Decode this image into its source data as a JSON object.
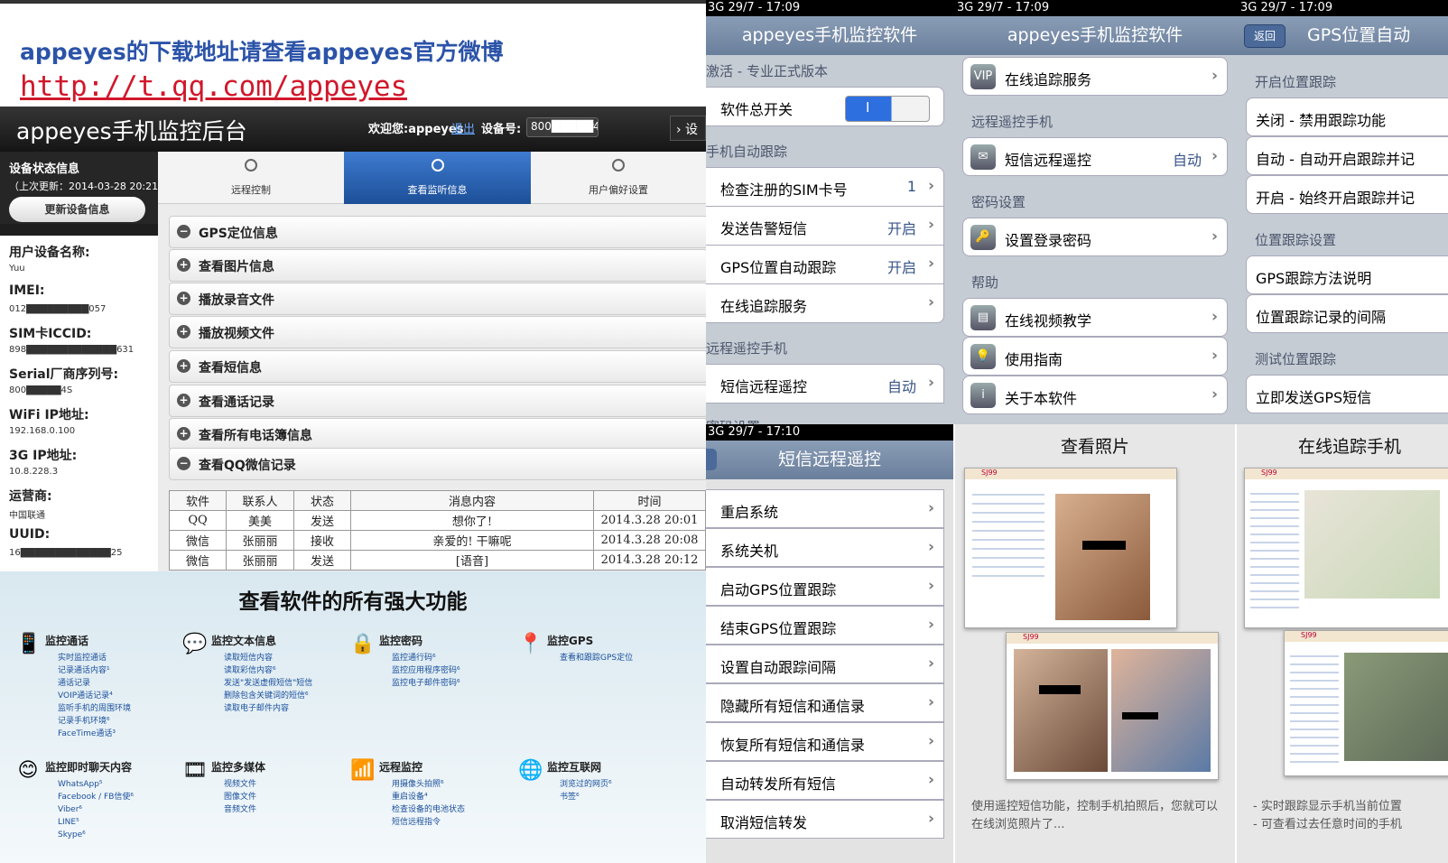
{
  "banner": {
    "line": "appeyes的下载地址请查看appeyes官方微博",
    "url": "http://t.qq.com/appeyes"
  },
  "admin": {
    "title": "appeyes手机监控后台",
    "welcome": "欢迎您:appeyes",
    "logout": "退出",
    "device_label": "设备号:",
    "device_value": "800█████4S",
    "right_btn": "›  设",
    "status_title": "设备状态信息",
    "status_time": "（上次更新：2014-03-28 20:21:00）",
    "update_btn": "更新设备信息",
    "device_info": [
      {
        "key": "用户设备名称:",
        "value": "Yuu"
      },
      {
        "key": "IMEI:",
        "value": "012█████████057"
      },
      {
        "key": "SIM卡ICCID:",
        "value": "898█████████████631"
      },
      {
        "key": "Serial厂商序列号:",
        "value": "800█████4S"
      },
      {
        "key": "WiFi IP地址:",
        "value": "192.168.0.100"
      },
      {
        "key": "3G IP地址:",
        "value": "10.8.228.3"
      },
      {
        "key": "运营商:",
        "value": "中国联通"
      },
      {
        "key": "UUID:",
        "value": "16█████████████25"
      }
    ],
    "tabs": [
      "远程控制",
      "查看监听信息",
      "用户偏好设置"
    ],
    "panel_rows": [
      {
        "icon": "−",
        "label": "GPS定位信息"
      },
      {
        "icon": "+",
        "label": "查看图片信息"
      },
      {
        "icon": "+",
        "label": "播放录音文件"
      },
      {
        "icon": "+",
        "label": "播放视频文件"
      },
      {
        "icon": "+",
        "label": "查看短信息"
      },
      {
        "icon": "+",
        "label": "查看通话记录"
      },
      {
        "icon": "+",
        "label": "查看所有电话簿信息"
      },
      {
        "icon": "−",
        "label": "查看QQ微信记录"
      }
    ],
    "table": {
      "headers": [
        "软件",
        "联系人",
        "状态",
        "消息内容",
        "时间"
      ],
      "rows": [
        [
          "QQ",
          "美美",
          "发送",
          "想你了!",
          "2014.3.28 20:01"
        ],
        [
          "微信",
          "张丽丽",
          "接收",
          "亲爱的! 干嘛呢",
          "2014.3.28 20:08"
        ],
        [
          "微信",
          "张丽丽",
          "发送",
          "[语音]",
          "2014.3.28 20:12"
        ]
      ]
    }
  },
  "features": {
    "title": "查看软件的所有强大功能",
    "blocks": [
      {
        "icon": "📱",
        "title": "监控通话",
        "items": [
          "实时监控通话",
          "记录通话内容¹",
          "通话记录",
          "VOIP通话记录⁴",
          "监听手机的周围环境",
          "记录手机环境⁶",
          "FaceTime通话³"
        ]
      },
      {
        "icon": "💬",
        "title": "监控文本信息",
        "items": [
          "读取短信内容",
          "读取彩信内容⁶",
          "发送\"发送虚假短信\"短信",
          "删除包含关键词的短信⁶",
          "读取电子邮件内容"
        ]
      },
      {
        "icon": "🔒",
        "title": "监控密码",
        "items": [
          "监控通行码⁶",
          "监控应用程序密码⁶",
          "监控电子邮件密码⁶"
        ]
      },
      {
        "icon": "📍",
        "title": "监控GPS",
        "items": [
          "查看和跟踪GPS定位"
        ]
      },
      {
        "icon": "😊",
        "title": "监控即时聊天内容",
        "items": [
          "WhatsApp⁵",
          "Facebook / FB信使⁶",
          "Viber⁶",
          "LINE⁵",
          "Skype⁶"
        ]
      },
      {
        "icon": "🎞",
        "title": "监控多媒体",
        "items": [
          "视频文件",
          "图像文件",
          "音频文件"
        ]
      },
      {
        "icon": "📶",
        "title": "远程监控",
        "items": [
          "用摄像头拍照⁶",
          "重启设备⁴",
          "检查设备的电池状态",
          "短信远程指令"
        ]
      },
      {
        "icon": "🌐",
        "title": "监控互联网",
        "items": [
          "浏览过的网页⁶",
          "书签⁶"
        ]
      }
    ]
  },
  "phone1": {
    "status": "3G          29/7 - 17:09",
    "title": "appeyes手机监控软件",
    "sections": [
      "激活 - 专业正式版本",
      "手机自动跟踪",
      "远程遥控手机",
      "密码设置"
    ],
    "switch_label": "软件总开关",
    "switch_value": "I",
    "cells": [
      {
        "label": "检查注册的SIM卡号",
        "value": "1"
      },
      {
        "label": "发送告警短信",
        "value": "开启"
      },
      {
        "label": "GPS位置自动跟踪",
        "value": "开启"
      },
      {
        "label": "在线追踪服务",
        "value": ""
      },
      {
        "label": "短信远程遥控",
        "value": "自动"
      }
    ]
  },
  "phone2": {
    "status": "3G          29/7 - 17:09",
    "title": "appeyes手机监控软件",
    "sections": [
      "远程遥控手机",
      "密码设置",
      "帮助"
    ],
    "cells": [
      {
        "icon": "VIP",
        "label": "在线追踪服务",
        "value": ""
      },
      {
        "icon": "✉",
        "label": "短信远程遥控",
        "value": "自动"
      },
      {
        "icon": "🔑",
        "label": "设置登录密码",
        "value": ""
      },
      {
        "icon": "▤",
        "label": "在线视频教学",
        "value": ""
      },
      {
        "icon": "💡",
        "label": "使用指南",
        "value": ""
      },
      {
        "icon": "i",
        "label": "关于本软件",
        "value": ""
      }
    ]
  },
  "phone3": {
    "status": "3G          29/7 - 17:09",
    "back": "返回",
    "title": "GPS位置自动",
    "sections": [
      "开启位置跟踪",
      "位置跟踪设置",
      "测试位置跟踪"
    ],
    "cells": [
      "关闭 - 禁用跟踪功能",
      "自动 - 自动开启跟踪并记",
      "开启 - 始终开启跟踪并记",
      "GPS跟踪方法说明",
      "位置跟踪记录的间隔",
      "立即发送GPS短信"
    ]
  },
  "phone4": {
    "status": "3G          29/7 - 17:10",
    "title": "短信远程遥控",
    "cells": [
      "重启系统",
      "系统关机",
      "启动GPS位置跟踪",
      "结束GPS位置跟踪",
      "设置自动跟踪间隔",
      "隐藏所有短信和通信录",
      "恢复所有短信和通信录",
      "自动转发所有短信",
      "取消短信转发"
    ]
  },
  "photos": {
    "title": "查看照片",
    "caption": "使用遥控短信功能，控制手机拍照后，您就可以在线浏览照片了..."
  },
  "tracking": {
    "title": "在线追踪手机",
    "caption": "- 实时跟踪显示手机当前位置\n- 可查看过去任意时间的手机"
  }
}
